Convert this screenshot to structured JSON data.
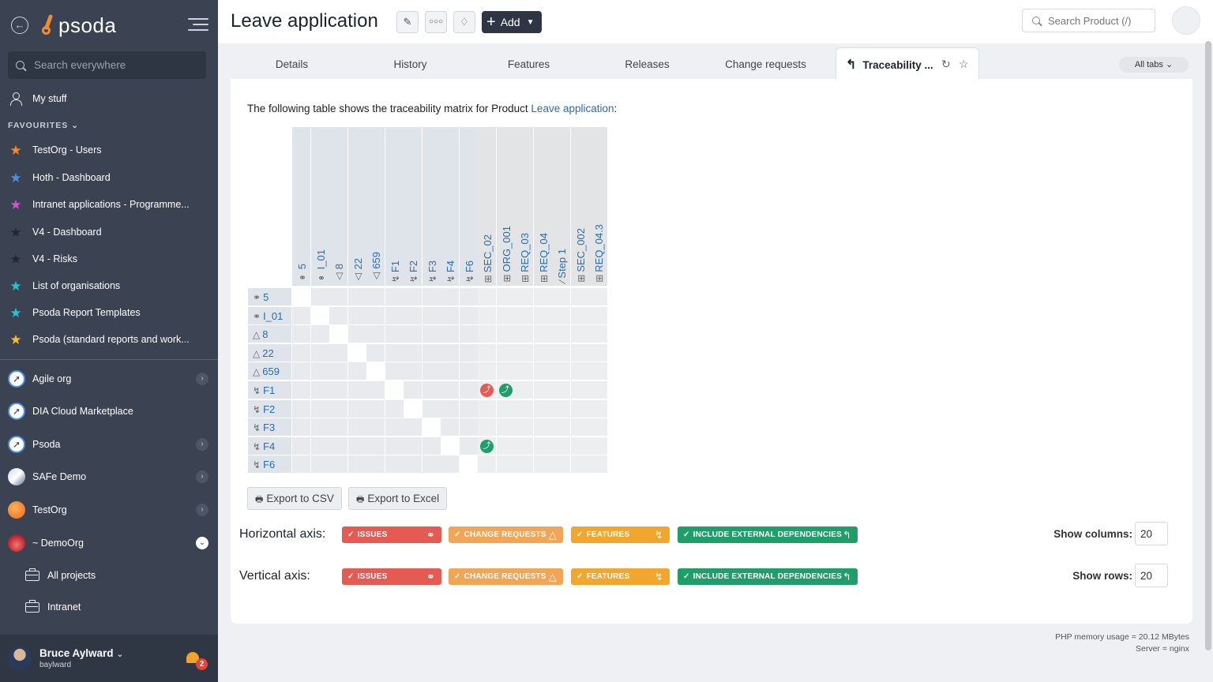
{
  "sidebar": {
    "logo_text": "psoda",
    "search_placeholder": "Search everywhere",
    "my_stuff": "My stuff",
    "favourites_heading": "FAVOURITES",
    "favourites": [
      {
        "label": "TestOrg - Users",
        "star_color": "#f28a2e"
      },
      {
        "label": "Hoth - Dashboard",
        "star_color": "#4a90e2"
      },
      {
        "label": "Intranet applications - Programme...",
        "star_color": "#d84fd0"
      },
      {
        "label": "V4 - Dashboard",
        "star_color": "#2a2f3a"
      },
      {
        "label": "V4 - Risks",
        "star_color": "#2a2f3a"
      },
      {
        "label": "List of organisations",
        "star_color": "#2bbfd6"
      },
      {
        "label": "Psoda Report Templates",
        "star_color": "#2bbfd6"
      },
      {
        "label": "Psoda (standard reports and work...",
        "star_color": "#f4c02f"
      }
    ],
    "orgs": [
      {
        "label": "Agile org",
        "expandable": true
      },
      {
        "label": "DIA Cloud Marketplace",
        "expandable": false
      },
      {
        "label": "Psoda",
        "expandable": true
      },
      {
        "label": "SAFe Demo",
        "expandable": true
      },
      {
        "label": "TestOrg",
        "expandable": true
      },
      {
        "label": "~ DemoOrg",
        "expandable": true,
        "open": true
      }
    ],
    "sub_items": [
      "All projects",
      "Intranet"
    ],
    "user": {
      "name": "Bruce Aylward",
      "handle": "baylward",
      "notifications": "2"
    }
  },
  "header": {
    "title": "Leave application",
    "add_label": "Add",
    "search_placeholder": "Search Product (/)"
  },
  "tabs": {
    "items": [
      "Details",
      "History",
      "Features",
      "Releases",
      "Change requests"
    ],
    "active": "Traceability ...",
    "all_tabs": "All tabs"
  },
  "content": {
    "intro_prefix": "The following table shows the traceability matrix for Product ",
    "intro_link": "Leave application",
    "intro_suffix": ":",
    "export_csv": "Export to CSV",
    "export_excel": "Export to Excel",
    "horizontal_axis": "Horizontal axis:",
    "vertical_axis": "Vertical axis:",
    "chips": [
      "ISSUES",
      "CHANGE REQUESTS",
      "FEATURES",
      "INCLUDE EXTERNAL DEPENDENCIES"
    ],
    "show_columns_label": "Show columns:",
    "show_columns_value": "20",
    "show_rows_label": "Show rows:",
    "show_rows_value": "20"
  },
  "matrix": {
    "columns": [
      {
        "label": "5",
        "type": "issue"
      },
      {
        "label": "I_01",
        "type": "issue"
      },
      {
        "label": "8",
        "type": "change-request"
      },
      {
        "label": "22",
        "type": "change-request"
      },
      {
        "label": "659",
        "type": "change-request"
      },
      {
        "label": "F1",
        "type": "feature"
      },
      {
        "label": "F2",
        "type": "feature"
      },
      {
        "label": "F3",
        "type": "feature"
      },
      {
        "label": "F4",
        "type": "feature"
      },
      {
        "label": "F6",
        "type": "feature"
      },
      {
        "label": "SEC_02",
        "type": "requirement"
      },
      {
        "label": "ORG_001",
        "type": "requirement"
      },
      {
        "label": "REQ_03",
        "type": "requirement"
      },
      {
        "label": "REQ_04",
        "type": "requirement"
      },
      {
        "label": "Step 1",
        "type": "step"
      },
      {
        "label": "SEC_002",
        "type": "requirement"
      },
      {
        "label": "REQ_04.3",
        "type": "requirement"
      }
    ],
    "rows": [
      {
        "label": "5",
        "type": "issue"
      },
      {
        "label": "I_01",
        "type": "issue"
      },
      {
        "label": "8",
        "type": "change-request"
      },
      {
        "label": "22",
        "type": "change-request"
      },
      {
        "label": "659",
        "type": "change-request"
      },
      {
        "label": "F1",
        "type": "feature"
      },
      {
        "label": "F2",
        "type": "feature"
      },
      {
        "label": "F3",
        "type": "feature"
      },
      {
        "label": "F4",
        "type": "feature"
      },
      {
        "label": "F6",
        "type": "feature"
      }
    ],
    "links": [
      {
        "row": 5,
        "col": 10,
        "kind": "red"
      },
      {
        "row": 5,
        "col": 11,
        "kind": "green"
      },
      {
        "row": 8,
        "col": 10,
        "kind": "green"
      }
    ]
  },
  "footer": {
    "memory": "PHP memory usage = 20.12 MBytes",
    "server": "Server = nginx"
  },
  "colors": {
    "sidebar_bg": "#3b4353",
    "link": "#2b6cb0",
    "issues": "#e55a52",
    "change_requests": "#f2a555",
    "features": "#f3a62e",
    "external": "#1f9d6a"
  }
}
